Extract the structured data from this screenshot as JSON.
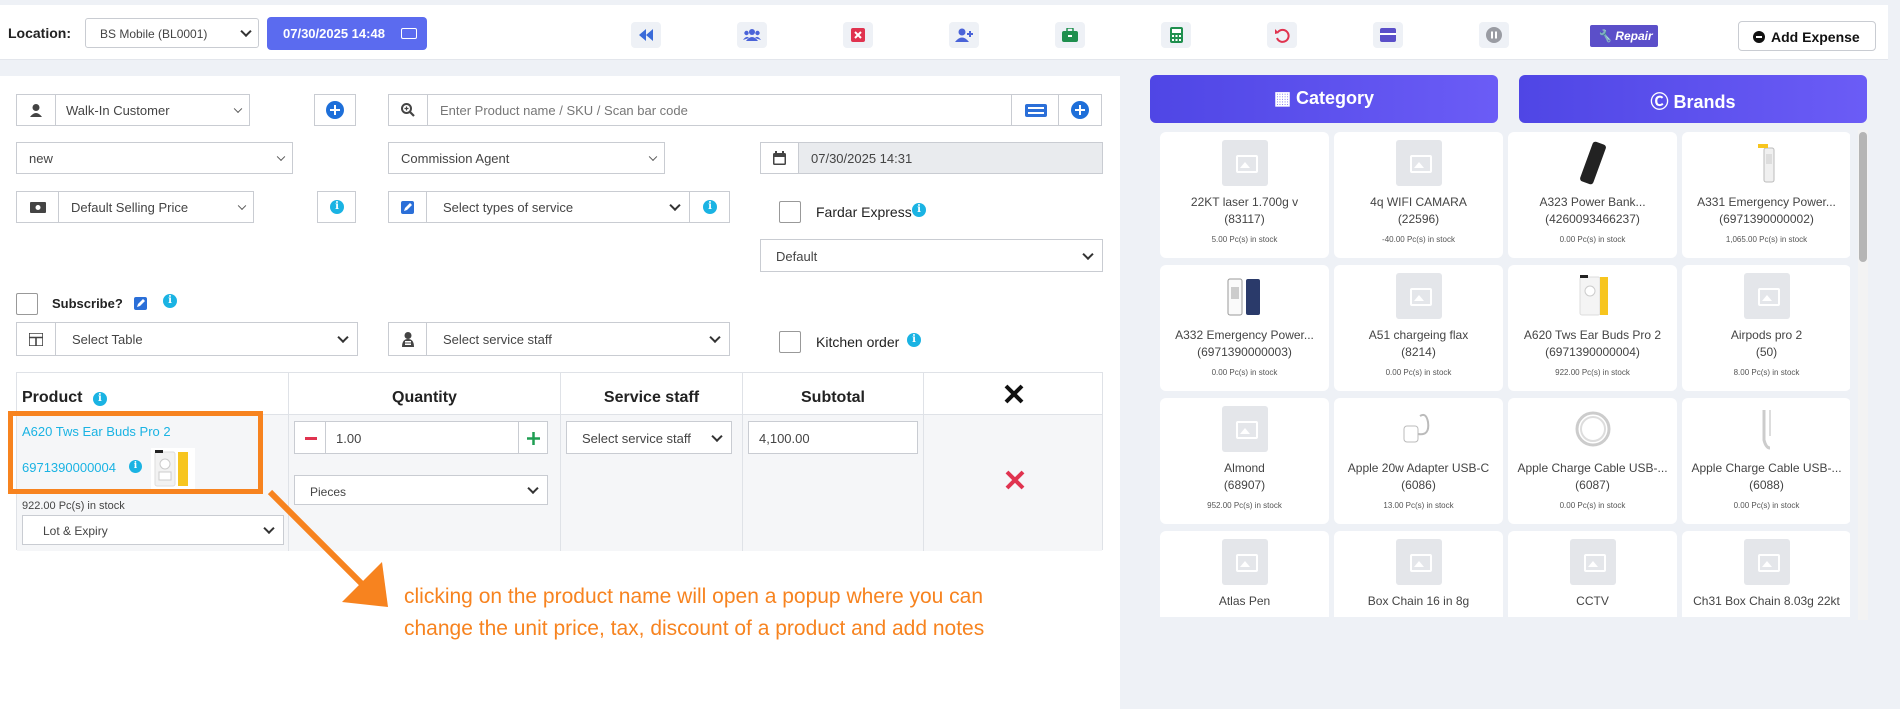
{
  "topbar": {
    "location_label": "Location:",
    "location_value": "BS Mobile (BL0001)",
    "datetime": "07/30/2025 14:48",
    "repair_label": "Repair",
    "add_expense_label": "Add Expense"
  },
  "form": {
    "customer": "Walk-In Customer",
    "product_search_placeholder": "Enter Product name / SKU / Scan bar code",
    "status_value": "new",
    "commission_agent": "Commission Agent",
    "transaction_date": "07/30/2025 14:31",
    "price_group": "Default Selling Price",
    "service_type_placeholder": "Select types of service",
    "fardar_express_label": "Fardar Express",
    "default_select": "Default",
    "subscribe_label": "Subscribe?",
    "table_placeholder": "Select Table",
    "service_staff_placeholder": "Select service staff",
    "kitchen_order_label": "Kitchen order"
  },
  "table": {
    "headers": [
      "Product",
      "Quantity",
      "Service staff",
      "Subtotal"
    ],
    "row": {
      "product_name": "A620 Tws Ear Buds Pro 2",
      "sku": "6971390000004",
      "stock": "922.00 Pc(s) in stock",
      "lot_select": "Lot & Expiry",
      "quantity": "1.00",
      "unit": "Pieces",
      "service_staff": "Select service staff",
      "subtotal": "4,100.00"
    }
  },
  "right_panel": {
    "category_label": "Category",
    "brands_label": "Brands",
    "products": [
      {
        "name": "22KT laser 1.700g v",
        "code": "(83117)",
        "stock": "5.00 Pc(s) in stock",
        "thumb": "placeholder"
      },
      {
        "name": "4q WIFI CAMARA",
        "code": "(22596)",
        "stock": "-40.00 Pc(s) in stock",
        "thumb": "placeholder"
      },
      {
        "name": "A323 Power Bank...",
        "code": "(4260093466237)",
        "stock": "0.00 Pc(s) in stock",
        "thumb": "powerbank"
      },
      {
        "name": "A331 Emergency Power...",
        "code": "(6971390000002)",
        "stock": "1,065.00 Pc(s) in stock",
        "thumb": "emergency"
      },
      {
        "name": "A332 Emergency Power...",
        "code": "(6971390000003)",
        "stock": "0.00 Pc(s) in stock",
        "thumb": "emergency2"
      },
      {
        "name": "A51 chargeing flax",
        "code": "(8214)",
        "stock": "0.00 Pc(s) in stock",
        "thumb": "placeholder"
      },
      {
        "name": "A620 Tws Ear Buds Pro 2",
        "code": "(6971390000004)",
        "stock": "922.00 Pc(s) in stock",
        "thumb": "earbuds"
      },
      {
        "name": "Airpods pro 2",
        "code": "(50)",
        "stock": "8.00 Pc(s) in stock",
        "thumb": "placeholder"
      },
      {
        "name": "Almond",
        "code": "(68907)",
        "stock": "952.00 Pc(s) in stock",
        "thumb": "placeholder"
      },
      {
        "name": "Apple 20w Adapter USB-C",
        "code": "(6086)",
        "stock": "13.00 Pc(s) in stock",
        "thumb": "adapter"
      },
      {
        "name": "Apple Charge Cable USB-...",
        "code": "(6087)",
        "stock": "0.00 Pc(s) in stock",
        "thumb": "cable"
      },
      {
        "name": "Apple Charge Cable USB-...",
        "code": "(6088)",
        "stock": "0.00 Pc(s) in stock",
        "thumb": "cable2"
      },
      {
        "name": "Atlas Pen",
        "code": "",
        "stock": "",
        "thumb": "placeholder"
      },
      {
        "name": "Box Chain 16 in 8g",
        "code": "",
        "stock": "",
        "thumb": "placeholder"
      },
      {
        "name": "CCTV",
        "code": "",
        "stock": "",
        "thumb": "placeholder"
      },
      {
        "name": "Ch31 Box Chain 8.03g 22kt",
        "code": "",
        "stock": "",
        "thumb": "placeholder"
      }
    ]
  },
  "annotation": {
    "line1": "clicking on the product name will open a popup where you can",
    "line2": "change the unit price, tax, discount of a product and add notes"
  },
  "colors": {
    "accent": "#5b6bef",
    "annotation": "#f7831f",
    "link": "#1ab3e3",
    "danger": "#e0334f"
  }
}
